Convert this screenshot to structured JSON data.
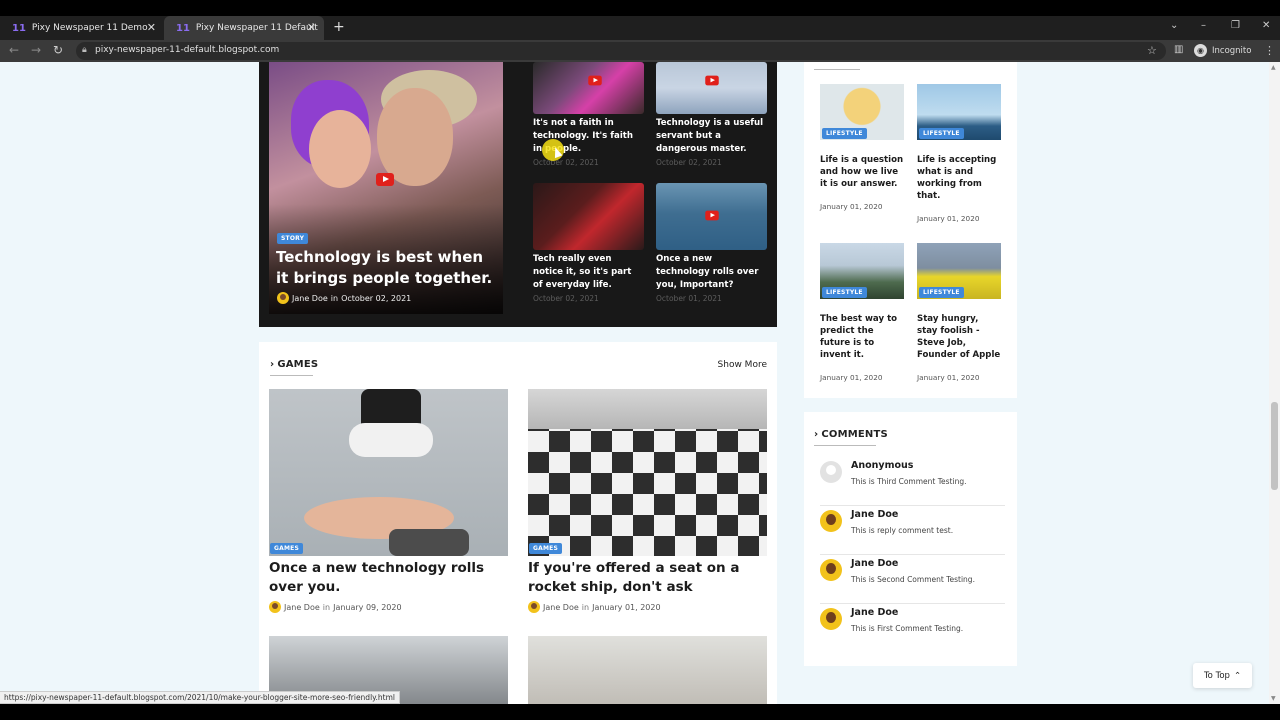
{
  "browser": {
    "tabs": [
      {
        "label": "Pixy Newspaper 11 Demo",
        "favicon": "11"
      },
      {
        "label": "Pixy Newspaper 11 Default",
        "favicon": "11"
      }
    ],
    "url": "pixy-newspaper-11-default.blogspot.com",
    "profile": "Incognito",
    "status_url": "https://pixy-newspaper-11-default.blogspot.com/2021/10/make-your-blogger-site-more-seo-friendly.html"
  },
  "featured": {
    "main": {
      "badge": "STORY",
      "title": "Technology is best when it brings people together.",
      "author": "Jane Doe",
      "in": "in",
      "date": "October 02, 2021"
    },
    "small": [
      {
        "title": "It's not a faith in technology. It's faith in people.",
        "date": "October 02, 2021"
      },
      {
        "title": "Technology is a useful servant but a dangerous master.",
        "date": "October 02, 2021"
      },
      {
        "title": "Tech really even notice it, so it's part of everyday life.",
        "date": "October 02, 2021"
      },
      {
        "title": "Once a new technology rolls over you, Important?",
        "date": "October 01, 2021"
      }
    ]
  },
  "games": {
    "heading": "GAMES",
    "show_more": "Show More",
    "posts": [
      {
        "badge": "GAMES",
        "title": "Once a new technology rolls over you.",
        "author": "Jane Doe",
        "in": "in",
        "date": "January 09, 2020"
      },
      {
        "badge": "GAMES",
        "title": "If you're offered a seat on a rocket ship, don't ask",
        "author": "Jane Doe",
        "in": "in",
        "date": "January 01, 2020"
      }
    ]
  },
  "lifestyle": {
    "posts": [
      {
        "badge": "LIFESTYLE",
        "title": "Life is a question and how we live it is our answer.",
        "date": "January 01, 2020"
      },
      {
        "badge": "LIFESTYLE",
        "title": "Life is accepting what is and working from that.",
        "date": "January 01, 2020"
      },
      {
        "badge": "LIFESTYLE",
        "title": "The best way to predict the future is to invent it.",
        "date": "January 01, 2020"
      },
      {
        "badge": "LIFESTYLE",
        "title": "Stay hungry, stay foolish - Steve Job, Founder of Apple",
        "date": "January 01, 2020"
      }
    ]
  },
  "comments": {
    "heading": "COMMENTS",
    "items": [
      {
        "name": "Anonymous",
        "text": "This is Third Comment Testing."
      },
      {
        "name": "Jane Doe",
        "text": "This is reply comment test."
      },
      {
        "name": "Jane Doe",
        "text": "This is Second Comment Testing."
      },
      {
        "name": "Jane Doe",
        "text": "This is First Comment Testing."
      }
    ]
  },
  "to_top": "To Top",
  "colors": {
    "badge": "#3f88d9",
    "featured_bg": "#181818",
    "page_bg": "#eef7fb"
  }
}
